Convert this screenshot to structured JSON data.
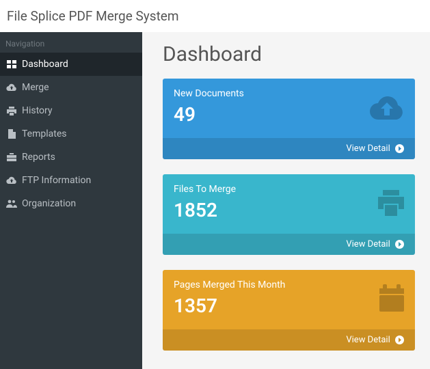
{
  "header": {
    "title": "File Splice PDF Merge System"
  },
  "sidebar": {
    "heading": "Navigation",
    "items": [
      {
        "label": "Dashboard"
      },
      {
        "label": "Merge"
      },
      {
        "label": "History"
      },
      {
        "label": "Templates"
      },
      {
        "label": "Reports"
      },
      {
        "label": "FTP Information"
      },
      {
        "label": "Organization"
      }
    ]
  },
  "page": {
    "title": "Dashboard"
  },
  "cards": [
    {
      "label": "New Documents",
      "value": "49",
      "footer": "View Detail"
    },
    {
      "label": "Files To Merge",
      "value": "1852",
      "footer": "View Detail"
    },
    {
      "label": "Pages Merged This Month",
      "value": "1357",
      "footer": "View Detail"
    }
  ]
}
